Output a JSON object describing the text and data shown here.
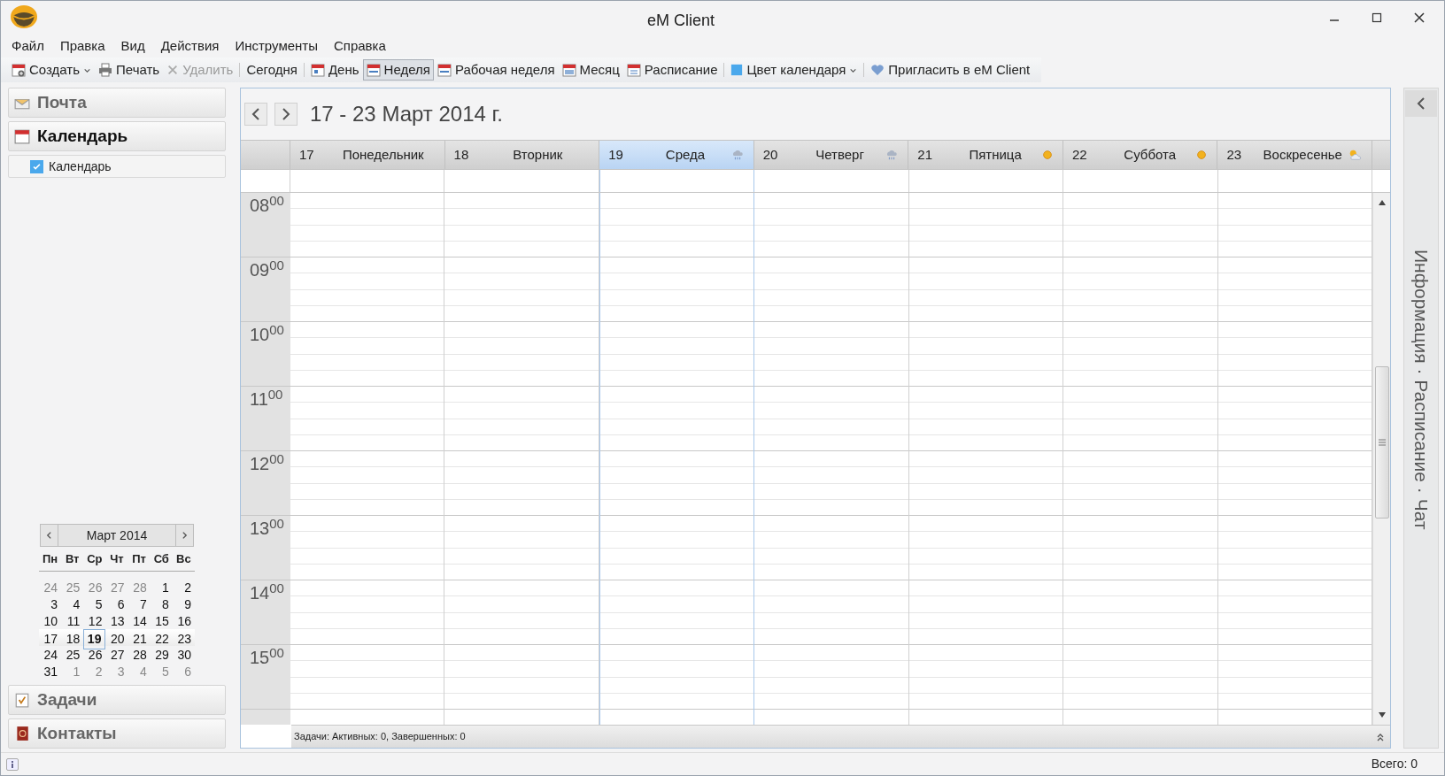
{
  "window": {
    "title": "eM Client"
  },
  "menu": [
    "Файл",
    "Правка",
    "Вид",
    "Действия",
    "Инструменты",
    "Справка"
  ],
  "toolbar": [
    {
      "kind": "new",
      "label": "Создать",
      "dropdown": true,
      "disabled": false,
      "selected": false,
      "separator_before": false
    },
    {
      "kind": "print",
      "label": "Печать",
      "dropdown": false,
      "disabled": false,
      "selected": false,
      "separator_before": false
    },
    {
      "kind": "delete",
      "label": "Удалить",
      "dropdown": false,
      "disabled": true,
      "selected": false,
      "separator_before": false
    },
    {
      "kind": "text",
      "label": "Сегодня",
      "dropdown": false,
      "disabled": false,
      "selected": false,
      "separator_before": true
    },
    {
      "kind": "day",
      "label": "День",
      "dropdown": false,
      "disabled": false,
      "selected": false,
      "separator_before": true
    },
    {
      "kind": "week",
      "label": "Неделя",
      "dropdown": false,
      "disabled": false,
      "selected": true,
      "separator_before": false
    },
    {
      "kind": "week",
      "label": "Рабочая неделя",
      "dropdown": false,
      "disabled": false,
      "selected": false,
      "separator_before": false
    },
    {
      "kind": "month",
      "label": "Месяц",
      "dropdown": false,
      "disabled": false,
      "selected": false,
      "separator_before": false
    },
    {
      "kind": "list",
      "label": "Расписание",
      "dropdown": false,
      "disabled": false,
      "selected": false,
      "separator_before": false
    },
    {
      "kind": "color",
      "label": "Цвет календаря",
      "dropdown": true,
      "disabled": false,
      "selected": false,
      "separator_before": true
    },
    {
      "kind": "heart",
      "label": "Пригласить в eM Client",
      "dropdown": false,
      "disabled": false,
      "selected": false,
      "separator_before": true
    }
  ],
  "sidebar": {
    "modules_top": [
      {
        "kind": "mail",
        "label": "Почта",
        "selected": false
      },
      {
        "kind": "calendar",
        "label": "Календарь",
        "selected": true
      }
    ],
    "calendars": [
      {
        "label": "Календарь",
        "checked": true
      }
    ],
    "mini_calendar": {
      "title": "Март 2014",
      "weekdays": [
        "Пн",
        "Вт",
        "Ср",
        "Чт",
        "Пт",
        "Сб",
        "Вс"
      ],
      "weeks": [
        {
          "selected": false,
          "days": [
            {
              "label": "24",
              "other_month": true,
              "today": false
            },
            {
              "label": "25",
              "other_month": true,
              "today": false
            },
            {
              "label": "26",
              "other_month": true,
              "today": false
            },
            {
              "label": "27",
              "other_month": true,
              "today": false
            },
            {
              "label": "28",
              "other_month": true,
              "today": false
            },
            {
              "label": "1",
              "other_month": false,
              "today": false
            },
            {
              "label": "2",
              "other_month": false,
              "today": false
            }
          ]
        },
        {
          "selected": false,
          "days": [
            {
              "label": "3",
              "other_month": false,
              "today": false
            },
            {
              "label": "4",
              "other_month": false,
              "today": false
            },
            {
              "label": "5",
              "other_month": false,
              "today": false
            },
            {
              "label": "6",
              "other_month": false,
              "today": false
            },
            {
              "label": "7",
              "other_month": false,
              "today": false
            },
            {
              "label": "8",
              "other_month": false,
              "today": false
            },
            {
              "label": "9",
              "other_month": false,
              "today": false
            }
          ]
        },
        {
          "selected": false,
          "days": [
            {
              "label": "10",
              "other_month": false,
              "today": false
            },
            {
              "label": "11",
              "other_month": false,
              "today": false
            },
            {
              "label": "12",
              "other_month": false,
              "today": false
            },
            {
              "label": "13",
              "other_month": false,
              "today": false
            },
            {
              "label": "14",
              "other_month": false,
              "today": false
            },
            {
              "label": "15",
              "other_month": false,
              "today": false
            },
            {
              "label": "16",
              "other_month": false,
              "today": false
            }
          ]
        },
        {
          "selected": true,
          "days": [
            {
              "label": "17",
              "other_month": false,
              "today": false
            },
            {
              "label": "18",
              "other_month": false,
              "today": false
            },
            {
              "label": "19",
              "other_month": false,
              "today": true
            },
            {
              "label": "20",
              "other_month": false,
              "today": false
            },
            {
              "label": "21",
              "other_month": false,
              "today": false
            },
            {
              "label": "22",
              "other_month": false,
              "today": false
            },
            {
              "label": "23",
              "other_month": false,
              "today": false
            }
          ]
        },
        {
          "selected": false,
          "days": [
            {
              "label": "24",
              "other_month": false,
              "today": false
            },
            {
              "label": "25",
              "other_month": false,
              "today": false
            },
            {
              "label": "26",
              "other_month": false,
              "today": false
            },
            {
              "label": "27",
              "other_month": false,
              "today": false
            },
            {
              "label": "28",
              "other_month": false,
              "today": false
            },
            {
              "label": "29",
              "other_month": false,
              "today": false
            },
            {
              "label": "30",
              "other_month": false,
              "today": false
            }
          ]
        },
        {
          "selected": false,
          "days": [
            {
              "label": "31",
              "other_month": false,
              "today": false
            },
            {
              "label": "1",
              "other_month": true,
              "today": false
            },
            {
              "label": "2",
              "other_month": true,
              "today": false
            },
            {
              "label": "3",
              "other_month": true,
              "today": false
            },
            {
              "label": "4",
              "other_month": true,
              "today": false
            },
            {
              "label": "5",
              "other_month": true,
              "today": false
            },
            {
              "label": "6",
              "other_month": true,
              "today": false
            }
          ]
        }
      ]
    },
    "modules_bottom": [
      {
        "kind": "tasks",
        "label": "Задачи",
        "selected": false
      },
      {
        "kind": "contacts",
        "label": "Контакты",
        "selected": false
      }
    ]
  },
  "calendar": {
    "range": "17 - 23 Март 2014 г.",
    "days": [
      {
        "date": "17",
        "name": "Понедельник",
        "kind": "plain",
        "selected": false
      },
      {
        "date": "18",
        "name": "Вторник",
        "kind": "plain",
        "selected": false
      },
      {
        "date": "19",
        "name": "Среда",
        "kind": "rain",
        "selected": true
      },
      {
        "date": "20",
        "name": "Четверг",
        "kind": "rain",
        "selected": false
      },
      {
        "date": "21",
        "name": "Пятница",
        "kind": "sun",
        "selected": false
      },
      {
        "date": "22",
        "name": "Суббота",
        "kind": "sun",
        "selected": false
      },
      {
        "date": "23",
        "name": "Воскресенье",
        "kind": "partly_cloudy",
        "selected": false
      }
    ],
    "hours": [
      "08$^{00}$",
      "09$^{00}$",
      "10$^{00}$",
      "11$^{00}$",
      "12$^{00}$",
      "13$^{00}$",
      "14$^{00}$",
      "15$^{00}$"
    ],
    "tasks_bar": "Задачи: Активных: 0, Завершенных: 0"
  },
  "right_panel": {
    "label": "Информация · Расписание · Чат"
  },
  "status_bar": {
    "total": "Всего: 0"
  }
}
